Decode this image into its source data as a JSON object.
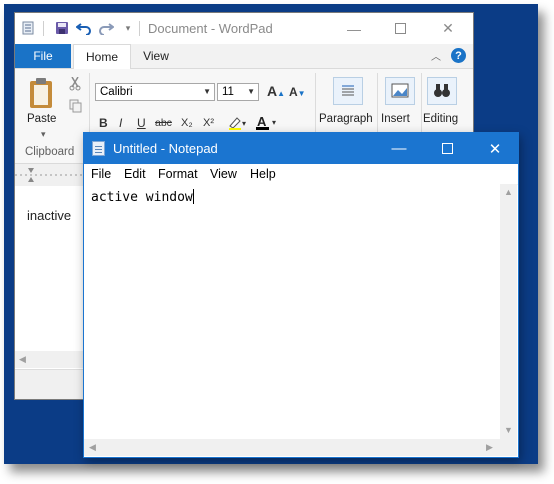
{
  "wordpad": {
    "title": "Document - WordPad",
    "tabs": {
      "file": "File",
      "home": "Home",
      "view": "View"
    },
    "ribbon": {
      "paste": "Paste",
      "clipboard": "Clipboard",
      "font_name": "Calibri",
      "font_size": "11",
      "paragraph": "Paragraph",
      "insert": "Insert",
      "editing": "Editing",
      "format_buttons": [
        "B",
        "I",
        "U",
        "abc",
        "X₂",
        "X²"
      ]
    },
    "document_text": "inactive"
  },
  "notepad": {
    "title": "Untitled - Notepad",
    "menu": [
      "File",
      "Edit",
      "Format",
      "View",
      "Help"
    ],
    "text": "active window"
  },
  "colors": {
    "desktop": "#0b3c86",
    "notepad_titlebar": "#1b75d0",
    "wordpad_file_tab": "#1a73c7"
  }
}
